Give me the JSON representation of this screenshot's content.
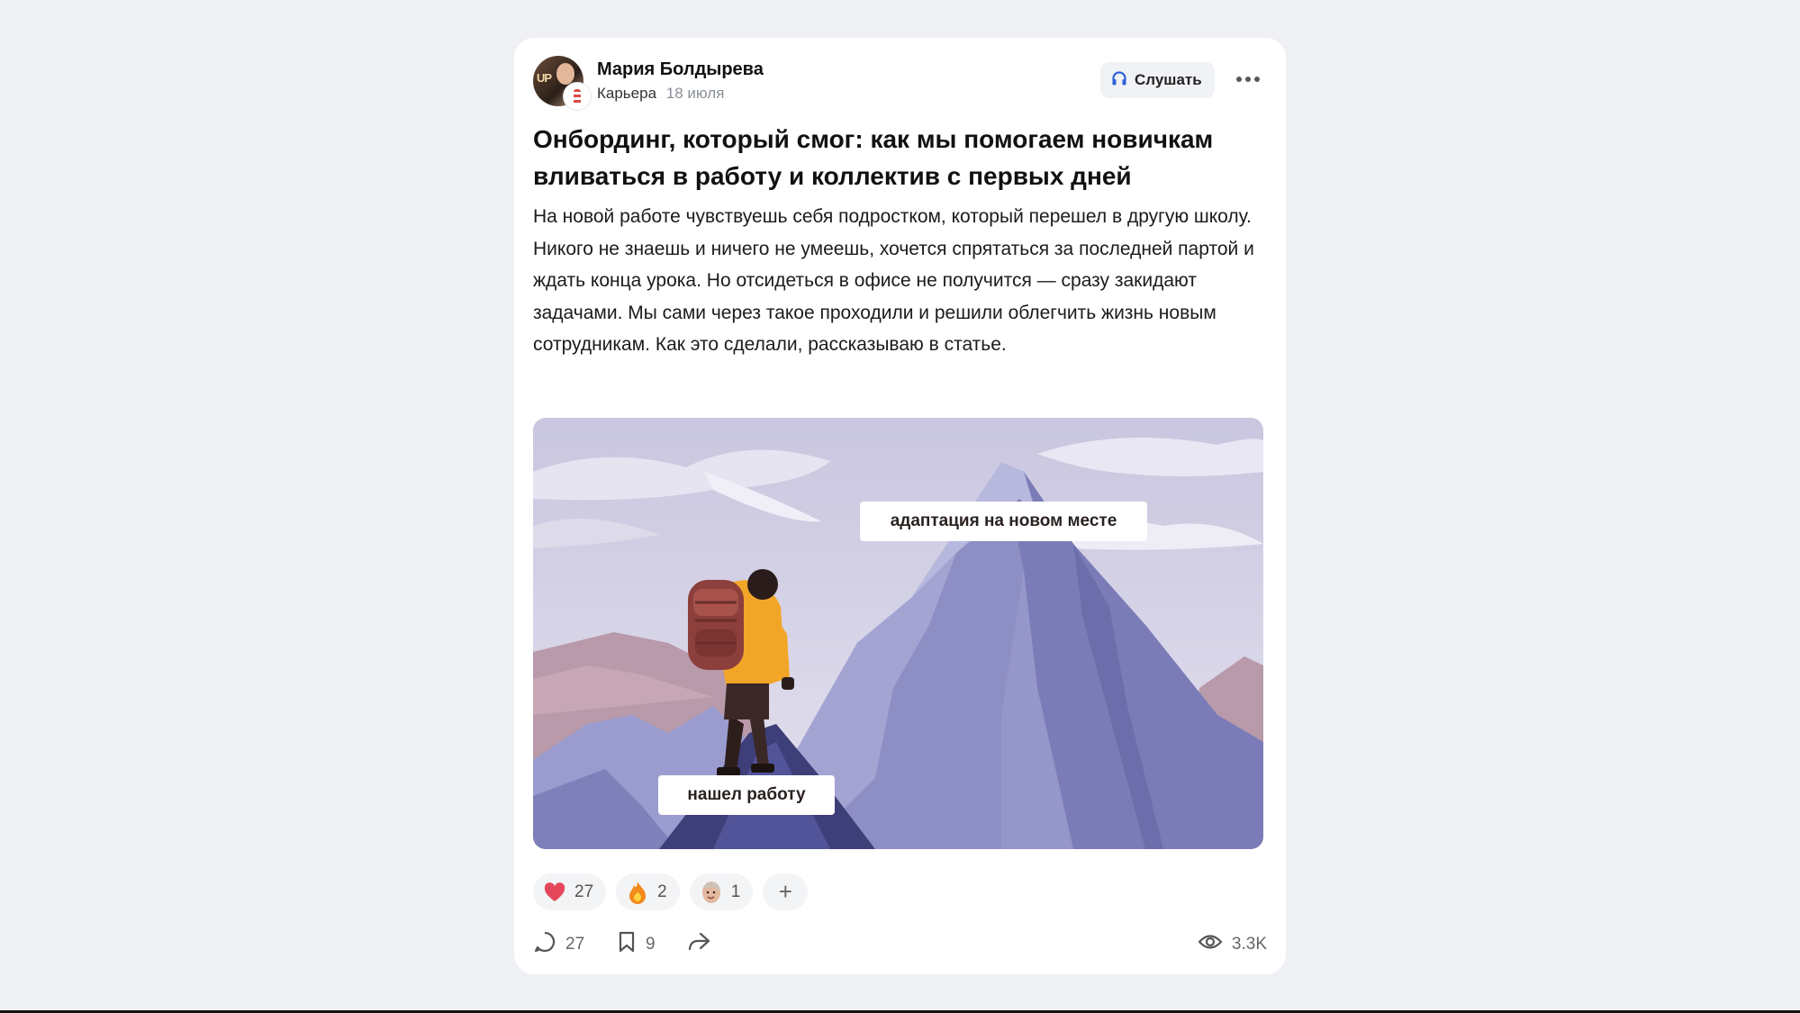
{
  "post": {
    "author_name": "Мария Болдырева",
    "avatar_text": "UP",
    "category": "Карьера",
    "date": "18 июля",
    "listen_label": "Слушать",
    "title": "Онбординг, который смог: как мы помогаем новичкам вливаться в работу и коллектив с первых дней",
    "body": "На новой работе чувствуешь себя подростком, который перешел в другую школу. Никого не знаешь и ничего не умеешь, хочется спрятаться за последней партой и ждать конца урока. Но отсидеться в офисе не получится — сразу закидают задачами. Мы сами через такое проходили и решили облегчить жизнь новым сотрудникам. Как это сделали, рассказываю в статье."
  },
  "image": {
    "label_top": "адаптация на новом месте",
    "label_bottom": "нашел работу"
  },
  "reactions": [
    {
      "icon": "heart-icon",
      "count": "27"
    },
    {
      "icon": "fire-icon",
      "count": "2"
    },
    {
      "icon": "face-emoji-icon",
      "count": "1"
    }
  ],
  "reaction_add_label": "+",
  "footer": {
    "comments": "27",
    "bookmarks": "9",
    "views": "3.3K"
  },
  "colors": {
    "page_bg": "#eef0f3",
    "card_bg": "#ffffff",
    "chip_bg": "#f3f4f6",
    "heart": "#e5475a",
    "listen_icon": "#2f62d8"
  }
}
